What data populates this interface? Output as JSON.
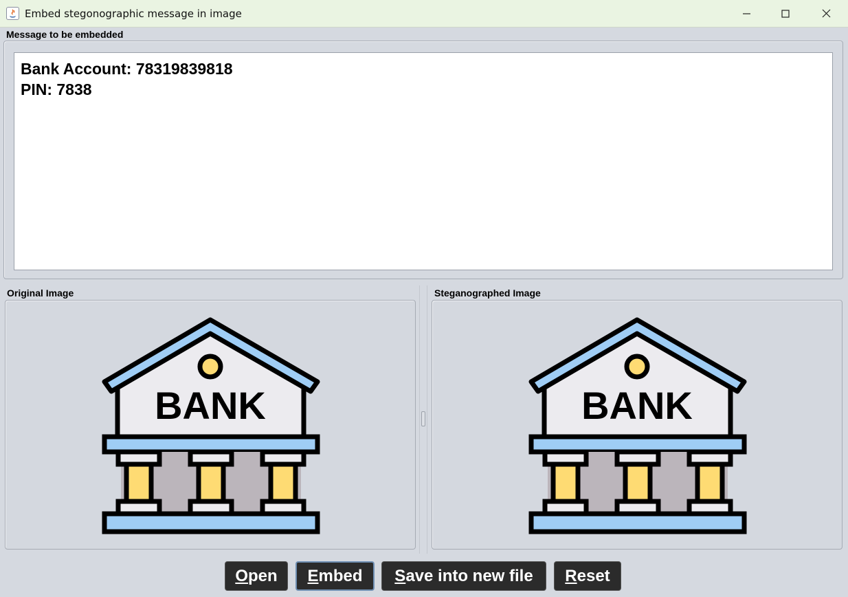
{
  "window": {
    "title": "Embed stegonographic message in image",
    "controls": {
      "minimize_icon": "minimize-icon",
      "maximize_icon": "maximize-icon",
      "close_icon": "close-icon"
    }
  },
  "message_section": {
    "label": "Message to be embedded",
    "lines": [
      "Bank Account: 78319839818",
      "PIN: 7838"
    ]
  },
  "original": {
    "label": "Original Image",
    "image_text": "BANK"
  },
  "stego": {
    "label": "Steganographed Image",
    "image_text": "BANK"
  },
  "buttons": {
    "open": {
      "mnemonic": "O",
      "rest": "pen"
    },
    "embed": {
      "mnemonic": "E",
      "rest": "mbed"
    },
    "save": {
      "mnemonic": "S",
      "rest": "ave into new file"
    },
    "reset": {
      "mnemonic": "R",
      "rest": "eset"
    }
  },
  "colors": {
    "roof_blue": "#9fcdf5",
    "wall": "#ecebef",
    "column_yellow": "#fedb73",
    "column_shade": "#f8bf55",
    "bank_inner_gray": "#bbb5bb",
    "button_bg": "#2b2b2b",
    "focus_border": "#6f8fb3"
  }
}
